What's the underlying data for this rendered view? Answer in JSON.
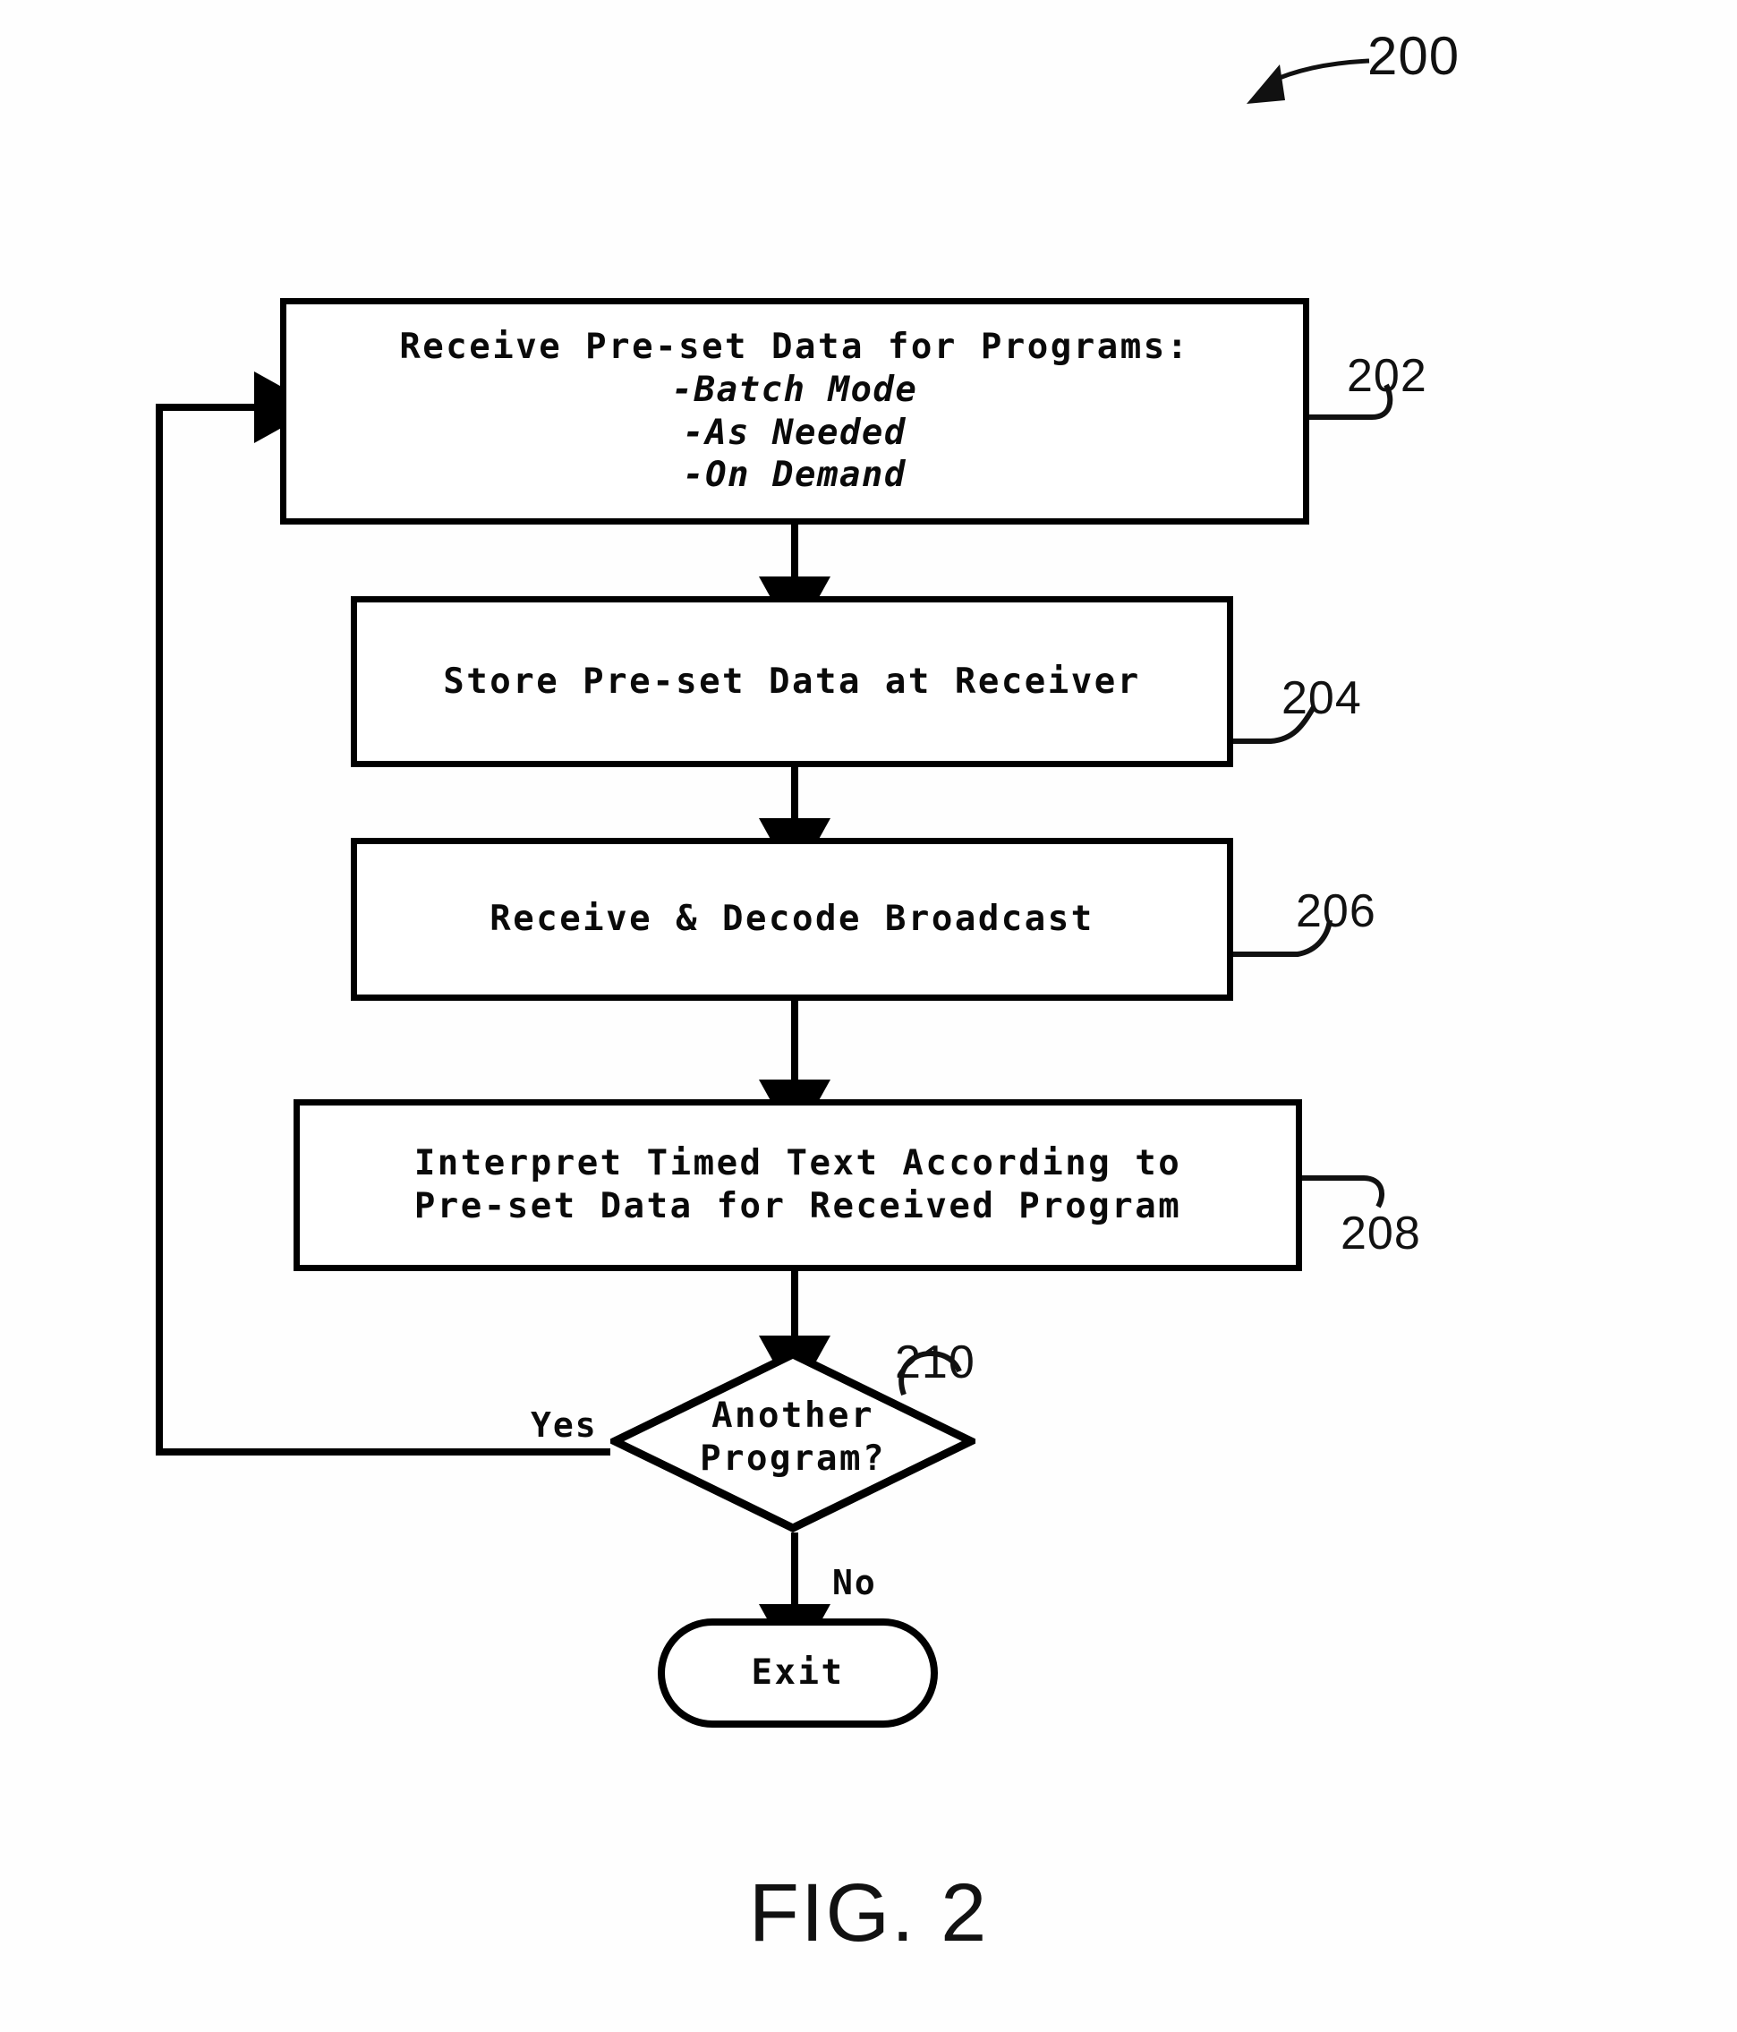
{
  "figure": {
    "caption": "FIG. 2",
    "reference": "200"
  },
  "nodes": [
    {
      "id": "step-202",
      "ref": "202",
      "shape": "process",
      "lines": [
        {
          "text": "Receive Pre-set Data for Programs:",
          "style": "normal"
        },
        {
          "text": "-Batch Mode",
          "style": "italic"
        },
        {
          "text": "-As Needed",
          "style": "italic"
        },
        {
          "text": "-On Demand",
          "style": "italic"
        }
      ]
    },
    {
      "id": "step-204",
      "ref": "204",
      "shape": "process",
      "lines": [
        {
          "text": "Store Pre-set Data at Receiver",
          "style": "normal"
        }
      ]
    },
    {
      "id": "step-206",
      "ref": "206",
      "shape": "process",
      "lines": [
        {
          "text": "Receive & Decode Broadcast",
          "style": "normal"
        }
      ]
    },
    {
      "id": "step-208",
      "ref": "208",
      "shape": "process",
      "lines": [
        {
          "text": "Interpret Timed Text According to",
          "style": "normal"
        },
        {
          "text": "Pre-set Data for Received Program",
          "style": "normal"
        }
      ]
    },
    {
      "id": "decision-210",
      "ref": "210",
      "shape": "decision",
      "lines": [
        {
          "text": "Another",
          "style": "normal"
        },
        {
          "text": "Program?",
          "style": "normal"
        }
      ]
    },
    {
      "id": "terminator-exit",
      "ref": "",
      "shape": "terminator",
      "lines": [
        {
          "text": "Exit",
          "style": "normal"
        }
      ]
    }
  ],
  "branches": {
    "yes_label": "Yes",
    "no_label": "No"
  },
  "colors": {
    "line": "#000000",
    "text": "#0a0a0a",
    "background": "#ffffff"
  }
}
